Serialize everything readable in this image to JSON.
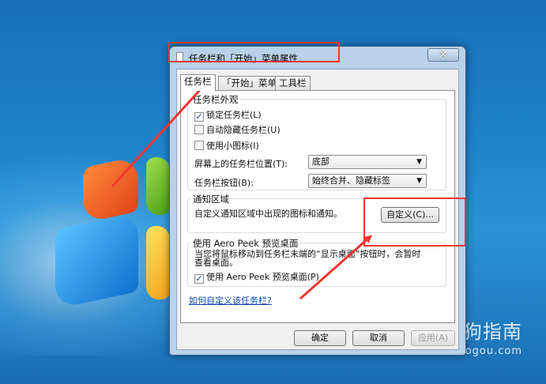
{
  "window": {
    "title": "任务栏和「开始」菜单属性",
    "close_label": "✕"
  },
  "tabs": [
    {
      "label": "任务栏",
      "active": true
    },
    {
      "label": "「开始」菜单",
      "active": false
    },
    {
      "label": "工具栏",
      "active": false
    }
  ],
  "appearance": {
    "title": "任务栏外观",
    "lock": {
      "label": "锁定任务栏(L)",
      "checked": true,
      "mark": "✓"
    },
    "autohide": {
      "label": "自动隐藏任务栏(U)",
      "checked": false
    },
    "small_icons": {
      "label": "使用小图标(I)",
      "checked": false
    },
    "location": {
      "label": "屏幕上的任务栏位置(T):",
      "value": "底部"
    },
    "buttons": {
      "label": "任务栏按钮(B):",
      "value": "始终合并、隐藏标签"
    }
  },
  "notification": {
    "title": "通知区域",
    "description": "自定义通知区域中出现的图标和通知。",
    "customize_label": "自定义(C)..."
  },
  "peek": {
    "title": "使用 Aero Peek 预览桌面",
    "description_line1": "当您将鼠标移动到任务栏末端的“显示桌面”按钮时，会暂时",
    "description_line2": "查看桌面。",
    "checkbox": {
      "label": "使用 Aero Peek 预览桌面(P)",
      "checked": true,
      "mark": "✓"
    }
  },
  "help_link": "如何自定义该任务栏?",
  "footer": {
    "ok": "确定",
    "cancel": "取消",
    "apply": "应用(A)"
  },
  "watermark": {
    "title": "搜狗指南",
    "url": "zhinan.sogou.com"
  },
  "colors": {
    "annotation": "#f0362d",
    "link": "#0645ad"
  }
}
